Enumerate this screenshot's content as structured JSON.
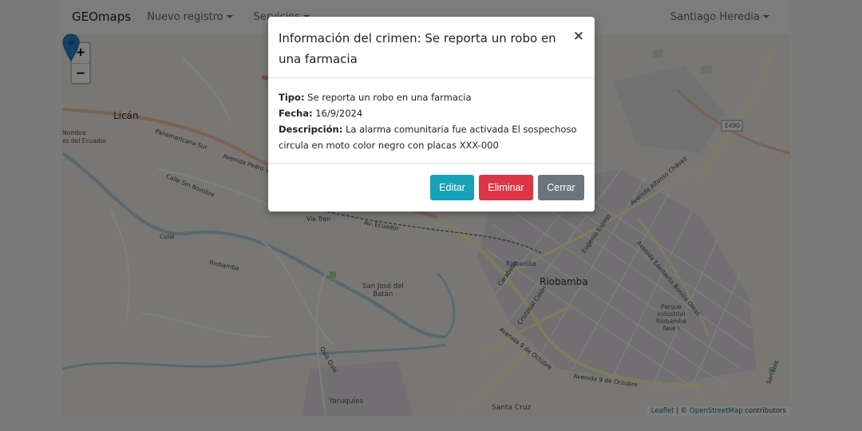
{
  "navbar": {
    "brand": "GEOmaps",
    "items": [
      {
        "label": "Nuevo registro"
      },
      {
        "label": "Servicios"
      }
    ],
    "user": "Santiago Heredia"
  },
  "map": {
    "zoom_in": "+",
    "zoom_out": "−",
    "labels": {
      "lican": "Licán",
      "nombre": "Nombre",
      "del_ecuador": "es del Ecuador",
      "panamericana": "Panamericana Sur",
      "av_pedro": "Avenida Pedro V",
      "calle_sin_nombre": "Calle Sin Nombre",
      "cunduana": "Culai",
      "riobamba_road": "Riobamba",
      "via_tren": "Vía Tren",
      "av_ecuador": "Av. Ecuador",
      "riobamba_station": "Riobamba",
      "riobamba": "Riobamba",
      "san_jose": "San José del\nBatán",
      "quis_quis": "Quis Quis",
      "yaruquies": "Yaruquíes",
      "santa_cruz": "Santa Cruz",
      "av_9_octubre": "Avenida 9 de Octubre",
      "av_9_octubre_2": "Avenida 9 de Octubre",
      "carabobo": "Carabobo",
      "cristobal_colon": "Cristóbal Colón",
      "eugenio_espejo": "Eugenio Espejo",
      "av_alfonso": "Avenida Alfonso Chávez",
      "av_edelberto": "Avenida Edelberto Bonilla Oleas",
      "parque": "Parque\nindustrial\nRiobamba\nfase I",
      "e490": "E490",
      "san_luis": "San Luis"
    },
    "attribution": {
      "leaflet": "Leaflet",
      "sep": " | © ",
      "osm": "OpenStreetMap",
      "contributors": " contributors"
    }
  },
  "modal": {
    "title": "Información del crimen: Se reporta un robo en una farmacia",
    "close": "×",
    "fields": {
      "tipo_label": "Tipo:",
      "tipo_value": " Se reporta un robo en una farmacia",
      "fecha_label": "Fecha:",
      "fecha_value": " 16/9/2024",
      "desc_label": "Descripción:",
      "desc_value": " La alarma comunitaria fue activada El sospechoso circula en moto color negro con placas XXX-000"
    },
    "buttons": {
      "edit": "Editar",
      "delete": "Eliminar",
      "close": "Cerrar"
    }
  },
  "colors": {
    "edit": "#17a2b8",
    "delete": "#dc3545",
    "close": "#6c757d",
    "marker": "#2a81cb"
  }
}
